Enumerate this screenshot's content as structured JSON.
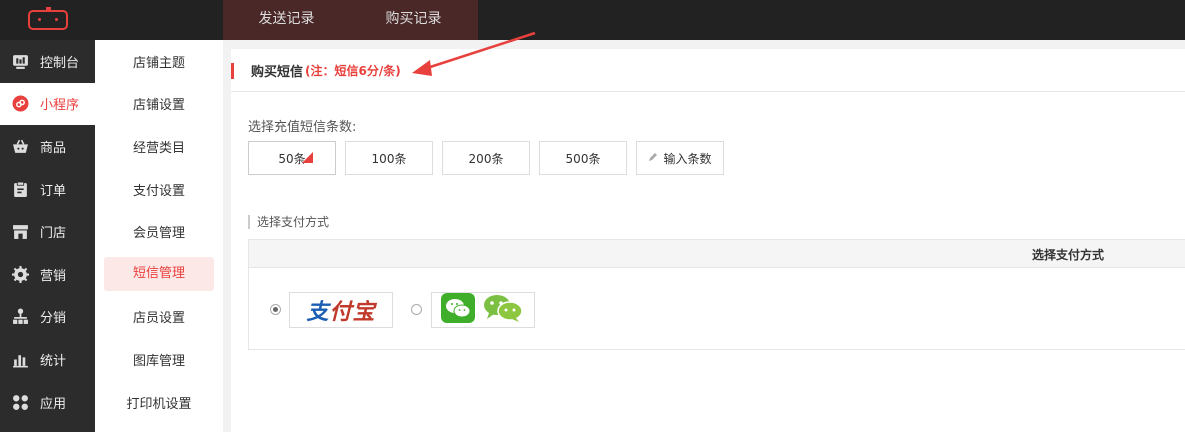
{
  "topbar": {
    "tabs": [
      "发送记录",
      "购买记录"
    ]
  },
  "sidebar": {
    "items": [
      {
        "label": "控制台",
        "icon": "dashboard-icon"
      },
      {
        "label": "小程序",
        "icon": "miniprogram-icon",
        "active": true
      },
      {
        "label": "商品",
        "icon": "basket-icon"
      },
      {
        "label": "订单",
        "icon": "clipboard-icon"
      },
      {
        "label": "门店",
        "icon": "store-icon"
      },
      {
        "label": "营销",
        "icon": "gear-icon"
      },
      {
        "label": "分销",
        "icon": "hierarchy-icon"
      },
      {
        "label": "统计",
        "icon": "bar-chart-icon"
      },
      {
        "label": "应用",
        "icon": "apps-icon"
      }
    ]
  },
  "submenu": {
    "items": [
      "店铺主题",
      "店铺设置",
      "经营类目",
      "支付设置",
      "会员管理",
      "短信管理",
      "店员设置",
      "图库管理",
      "打印机设置"
    ],
    "active_index": 5
  },
  "main": {
    "title": "购买短信",
    "note": "(注：短信6分/条)",
    "recharge_label": "选择充值短信条数:",
    "options": [
      "50条",
      "100条",
      "200条",
      "500条"
    ],
    "custom_option": "输入条数",
    "pay_section_label": "选择支付方式",
    "pay_table_header": "选择支付方式",
    "alipay_logo_text": "支付宝",
    "selected_payment": "alipay"
  },
  "colors": {
    "accent": "#e8403d",
    "topbar": "#222222",
    "sidebar": "#2c2c2c"
  }
}
